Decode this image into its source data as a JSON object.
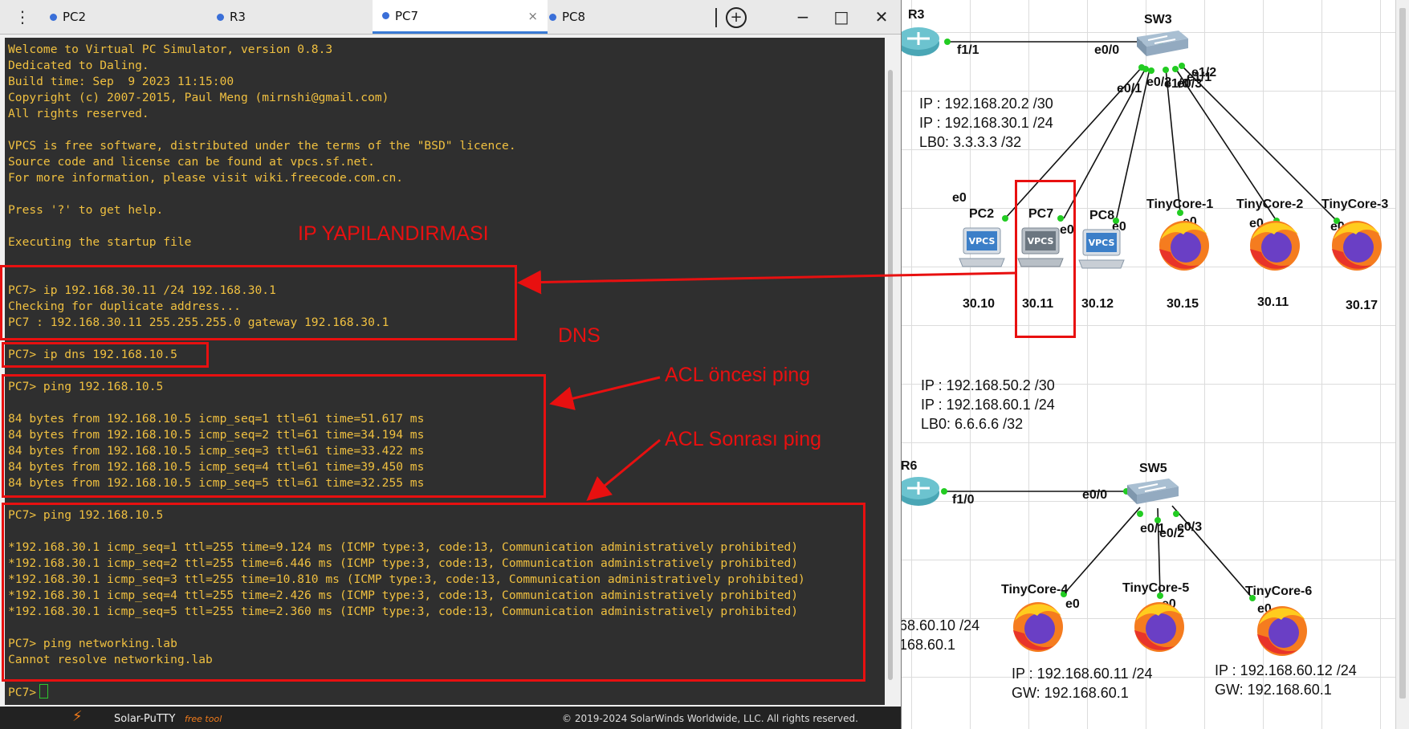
{
  "tabs": [
    {
      "label": "PC2",
      "active": false
    },
    {
      "label": "R3",
      "active": false
    },
    {
      "label": "PC7",
      "active": true
    },
    {
      "label": "PC8",
      "active": false
    }
  ],
  "window_controls": {
    "minimize": "−",
    "maximize": "□",
    "close": "✕",
    "new_tab": "+",
    "menu": "⋮",
    "tab_close": "×"
  },
  "terminal": {
    "lines": [
      "Welcome to Virtual PC Simulator, version 0.8.3",
      "Dedicated to Daling.",
      "Build time: Sep  9 2023 11:15:00",
      "Copyright (c) 2007-2015, Paul Meng (mirnshi@gmail.com)",
      "All rights reserved.",
      "",
      "VPCS is free software, distributed under the terms of the \"BSD\" licence.",
      "Source code and license can be found at vpcs.sf.net.",
      "For more information, please visit wiki.freecode.com.cn.",
      "",
      "Press '?' to get help.",
      "",
      "Executing the startup file",
      "",
      "",
      "PC7> ip 192.168.30.11 /24 192.168.30.1",
      "Checking for duplicate address...",
      "PC7 : 192.168.30.11 255.255.255.0 gateway 192.168.30.1",
      "",
      "PC7> ip dns 192.168.10.5",
      "",
      "PC7> ping 192.168.10.5",
      "",
      "84 bytes from 192.168.10.5 icmp_seq=1 ttl=61 time=51.617 ms",
      "84 bytes from 192.168.10.5 icmp_seq=2 ttl=61 time=34.194 ms",
      "84 bytes from 192.168.10.5 icmp_seq=3 ttl=61 time=33.422 ms",
      "84 bytes from 192.168.10.5 icmp_seq=4 ttl=61 time=39.450 ms",
      "84 bytes from 192.168.10.5 icmp_seq=5 ttl=61 time=32.255 ms",
      "",
      "PC7> ping 192.168.10.5",
      "",
      "*192.168.30.1 icmp_seq=1 ttl=255 time=9.124 ms (ICMP type:3, code:13, Communication administratively prohibited)",
      "*192.168.30.1 icmp_seq=2 ttl=255 time=6.446 ms (ICMP type:3, code:13, Communication administratively prohibited)",
      "*192.168.30.1 icmp_seq=3 ttl=255 time=10.810 ms (ICMP type:3, code:13, Communication administratively prohibited)",
      "*192.168.30.1 icmp_seq=4 ttl=255 time=2.426 ms (ICMP type:3, code:13, Communication administratively prohibited)",
      "*192.168.30.1 icmp_seq=5 ttl=255 time=2.360 ms (ICMP type:3, code:13, Communication administratively prohibited)",
      "",
      "PC7> ping networking.lab",
      "Cannot resolve networking.lab",
      "",
      "PC7>"
    ]
  },
  "annotations": {
    "ip_config": "IP YAPILANDIRMASI",
    "dns": "DNS",
    "acl_before": "ACL öncesi ping",
    "acl_after": "ACL Sonrası ping"
  },
  "footer": {
    "app_name": "Solar-PuTTY",
    "free_tool": "free tool",
    "copyright": "© 2019-2024 SolarWinds Worldwide, LLC. All rights reserved."
  },
  "topology": {
    "nodes": {
      "r3": "R3",
      "sw3": "SW3",
      "r6": "R6",
      "sw5": "SW5",
      "pc2": "PC2",
      "pc7": "PC7",
      "pc8": "PC8",
      "tc1": "TinyCore-1",
      "tc2": "TinyCore-2",
      "tc3": "TinyCore-3",
      "tc4": "TinyCore-4",
      "tc5": "TinyCore-5",
      "tc6": "TinyCore-6"
    },
    "vpcs_icon": "VPCS",
    "ports": {
      "r3_f": "f1/1",
      "sw3_e00": "e0/0",
      "sw3_e01": "e0/1",
      "sw3_e02": "e0/2",
      "sw3_e03": "e0/3",
      "sw3_e11": "e1/1",
      "sw3_e12": "e1/2",
      "sw3_e10": "e1/0",
      "pc2_e0": "e0",
      "pc7_e0": "e0",
      "pc8_e0": "e0",
      "tc1_e0": "e0",
      "tc2_e0": "e0",
      "tc3_e0": "e0",
      "r6_f": "f1/0",
      "sw5_e00": "e0/0",
      "sw5_e01": "e0/1",
      "sw5_e02": "e0/2",
      "sw5_e03": "e0/3",
      "tc4_e0": "e0",
      "tc5_e0": "e0",
      "tc6_e0": "e0"
    },
    "host_suffixes": {
      "pc2": "30.10",
      "pc7": "30.11",
      "pc8": "30.12",
      "tc1": "30.15",
      "tc2": "30.11",
      "tc3": "30.17"
    },
    "notes": {
      "sw3_block": [
        "IP : 192.168.20.2 /30",
        "IP : 192.168.30.1 /24",
        "LB0: 3.3.3.3 /32"
      ],
      "sw5_block": [
        "IP : 192.168.50.2 /30",
        "IP : 192.168.60.1 /24",
        "LB0: 6.6.6.6 /32"
      ],
      "tc4_block": [
        "68.60.10 /24",
        "168.60.1"
      ],
      "tc5_block": [
        "IP : 192.168.60.11 /24",
        "GW: 192.168.60.1"
      ],
      "tc6_block": [
        "IP : 192.168.60.12 /24",
        "GW: 192.168.60.1"
      ]
    }
  },
  "colors": {
    "terminal_bg": "#2f2f2f",
    "terminal_text": "#f0c040",
    "annotation_red": "#e81010",
    "link_dot": "#22cc22",
    "tab_accent": "#3a7bd5"
  }
}
